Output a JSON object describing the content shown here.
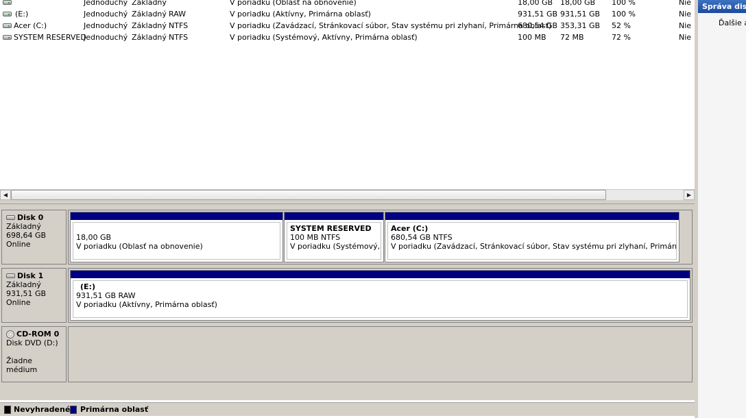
{
  "volumes": [
    {
      "name": "",
      "layout": "Jednoduchý",
      "type": "Základný",
      "fs": "",
      "status": "V poriadku (Oblasť na obnovenie)",
      "capacity": "18,00 GB",
      "free": "18,00 GB",
      "pct_free": "100 %",
      "fault": "Nie"
    },
    {
      "name": "(E:)",
      "layout": "Jednoduchý",
      "type": "Základný",
      "fs": "RAW",
      "status": "V poriadku (Aktívny, Primárna oblasť)",
      "capacity": "931,51 GB",
      "free": "931,51 GB",
      "pct_free": "100 %",
      "fault": "Nie"
    },
    {
      "name": "Acer (C:)",
      "layout": "Jednoduchý",
      "type": "Základný",
      "fs": "NTFS",
      "status": "V poriadku (Zavádzací, Stránkovací súbor, Stav systému pri zlyhaní, Primárna oblasť)",
      "capacity": "680,54 GB",
      "free": "353,31 GB",
      "pct_free": "52 %",
      "fault": "Nie"
    },
    {
      "name": "SYSTEM RESERVED",
      "layout": "Jednoduchý",
      "type": "Základný",
      "fs": "NTFS",
      "status": "V poriadku (Systémový, Aktívny, Primárna oblasť)",
      "capacity": "100 MB",
      "free": "72 MB",
      "pct_free": "72 %",
      "fault": "Nie"
    }
  ],
  "scrollbar": {
    "left_arrow": "◀",
    "right_arrow": "▶"
  },
  "disks": [
    {
      "title": "Disk 0",
      "type": "Základný",
      "size": "698,64 GB",
      "state": "Online",
      "partitions": [
        {
          "name": "",
          "size_fs": "18,00 GB",
          "status": "V poriadku (Oblasť na obnovenie)"
        },
        {
          "name": "SYSTEM RESERVED",
          "size_fs": "100 MB NTFS",
          "status": "V poriadku (Systémový, Akt"
        },
        {
          "name": "Acer  (C:)",
          "size_fs": "680,54 GB NTFS",
          "status": "V poriadku (Zavádzací, Stránkovací súbor, Stav systému pri zlyhaní, Primárna oblasť)"
        }
      ]
    },
    {
      "title": "Disk 1",
      "type": "Základný",
      "size": "931,51 GB",
      "state": "Online",
      "partitions": [
        {
          "name": "(E:)",
          "size_fs": "931,51 GB RAW",
          "status": "V poriadku (Aktívny, Primárna oblasť)"
        }
      ]
    }
  ],
  "cdrom": {
    "title": "CD-ROM 0",
    "drive": "Disk DVD (D:)",
    "media": "Žiadne médium"
  },
  "legend": [
    {
      "label": "Nevyhradené",
      "color": "#000000"
    },
    {
      "label": "Primárna oblasť",
      "color": "#000080"
    }
  ],
  "actions": {
    "header": "Správa diskov",
    "more": "Ďalšie akcie"
  },
  "colors": {
    "partition_bar": "#000080",
    "panel_bg": "#d4d0c8"
  }
}
